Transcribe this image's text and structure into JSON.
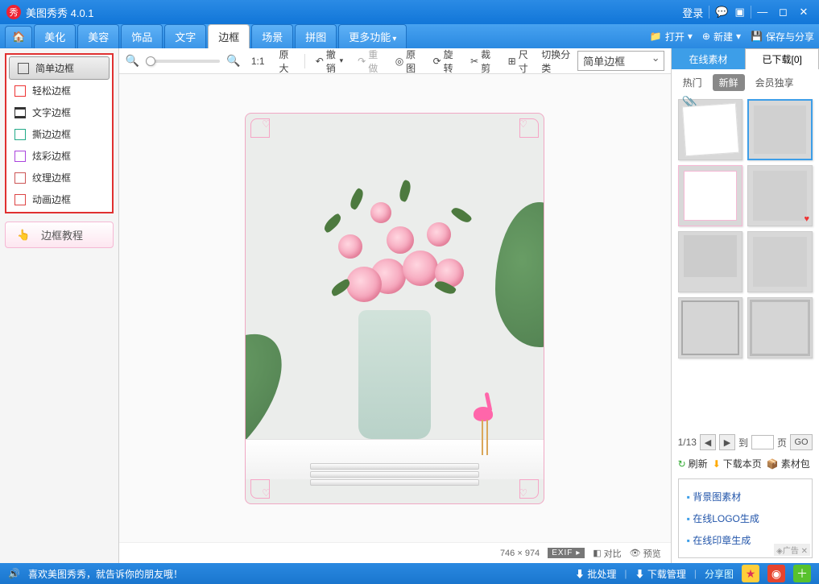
{
  "title": "美图秀秀 4.0.1",
  "titlebar": {
    "login": "登录"
  },
  "tabs": {
    "beautify": "美化",
    "beauty": "美容",
    "ornament": "饰品",
    "text": "文字",
    "frame": "边框",
    "scene": "场景",
    "puzzle": "拼图",
    "more": "更多功能"
  },
  "mainright": {
    "open": "打开",
    "new": "新建",
    "save_share": "保存与分享"
  },
  "sidebar": {
    "items": [
      {
        "label": "简单边框",
        "color": "#555"
      },
      {
        "label": "轻松边框",
        "color": "#e33"
      },
      {
        "label": "文字边框",
        "color": "#333"
      },
      {
        "label": "撕边边框",
        "color": "#2a8"
      },
      {
        "label": "炫彩边框",
        "color": "#a4d"
      },
      {
        "label": "纹理边框",
        "color": "#c55"
      },
      {
        "label": "动画边框",
        "color": "#d44"
      }
    ],
    "tutorial": "边框教程"
  },
  "toolbar": {
    "zoom11": "1:1",
    "original": "原大",
    "undo": "撤销",
    "redo": "重做",
    "orig": "原图",
    "rotate": "旋转",
    "crop": "裁剪",
    "size": "尺寸",
    "switch": "切换分类",
    "dropdown": "简单边框"
  },
  "imgfoot": {
    "dims": "746 × 974",
    "exif": "EXIF",
    "compare": "对比",
    "preview": "预览"
  },
  "right": {
    "tab_online": "在线素材",
    "tab_downloaded": "已下载[0]",
    "filters": {
      "hot": "热门",
      "new": "新鲜",
      "vip": "会员独享"
    },
    "pager": {
      "pos": "1/13",
      "to": "到",
      "page": "页",
      "go": "GO"
    },
    "actions": {
      "refresh": "刷新",
      "download": "下载本页",
      "pack": "素材包"
    },
    "links": {
      "bg": "背景图素材",
      "logo": "在线LOGO生成",
      "stamp": "在线印章生成",
      "ad": "◈广告"
    }
  },
  "status": {
    "slogan": "喜欢美图秀秀，就告诉你的朋友哦！",
    "batch": "批处理",
    "dlmgr": "下载管理",
    "share": "分享图"
  }
}
